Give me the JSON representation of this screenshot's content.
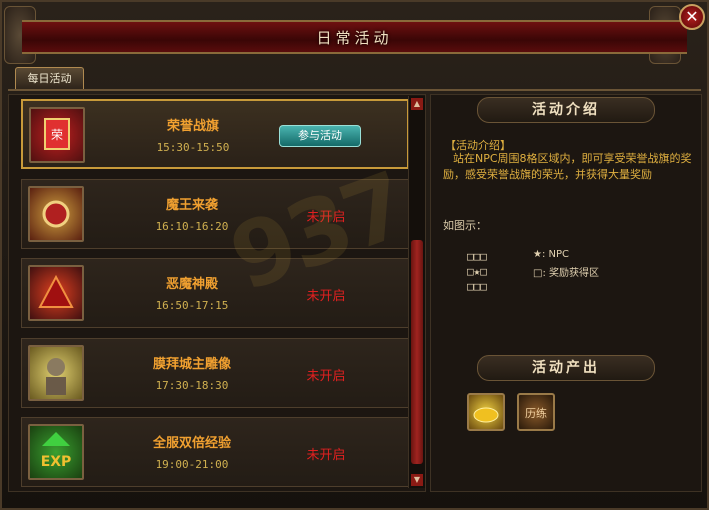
{
  "window": {
    "title": "日常活动",
    "close_symbol": "✕"
  },
  "tabs": [
    {
      "label": "每日活动",
      "selected": true
    }
  ],
  "activities": [
    {
      "name": "荣誉战旗",
      "time": "15:30-15:50",
      "status": "",
      "button": "参与活动",
      "icon": "banner-icon",
      "selected": true
    },
    {
      "name": "魔王来袭",
      "time": "16:10-16:20",
      "status": "未开启",
      "icon": "demon-king-icon"
    },
    {
      "name": "恶魔神殿",
      "time": "16:50-17:15",
      "status": "未开启",
      "icon": "demon-temple-icon"
    },
    {
      "name": "膜拜城主雕像",
      "time": "17:30-18:30",
      "status": "未开启",
      "icon": "statue-icon"
    },
    {
      "name": "全服双倍经验",
      "time": "19:00-21:00",
      "status": "未开启",
      "icon": "exp-icon"
    }
  ],
  "scroll": {
    "up": "▲",
    "down": "▼"
  },
  "intro": {
    "heading": "活动介绍",
    "label": "【活动介绍】",
    "text": "站在NPC周围8格区域内，即可享受荣誉战旗的奖励，感受荣誉战旗的荣光，并获得大量奖励",
    "example_label": "如图示：",
    "grid": "□□□\n□★□\n□□□",
    "legend_npc": "★: NPC",
    "legend_area": "□: 奖励获得区"
  },
  "output": {
    "heading": "活动产出",
    "rewards": [
      "gold-ingot-icon",
      "training-token-icon"
    ]
  },
  "watermark": "937"
}
